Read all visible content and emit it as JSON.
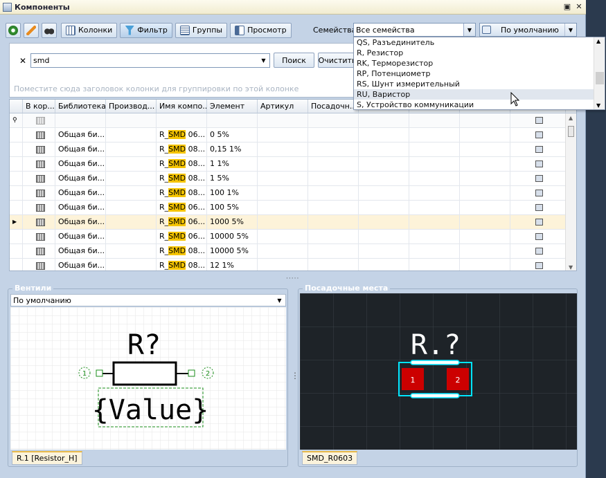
{
  "window": {
    "title": "Компоненты"
  },
  "toolbar": {
    "columns_label": "Колонки",
    "filter_label": "Фильтр",
    "groups_label": "Группы",
    "preview_label": "Просмотр"
  },
  "families": {
    "label": "Семейства",
    "value": "Все семейства",
    "view_value": "По умолчанию",
    "options": [
      "QS, Разъединитель",
      "R, Резистор",
      "RK, Терморезистор",
      "RP, Потенциометр",
      "RS, Шунт измерительный",
      "RU, Варистор",
      "S, Устройство коммуникации"
    ]
  },
  "search": {
    "value": "smd",
    "search_label": "Поиск",
    "clear_label": "Очистить",
    "group_hint": "Поместите сюда заголовок колонки для группировки по этой колонке"
  },
  "grid": {
    "columns": [
      "В кор...",
      "Библиотека",
      "Производ...",
      "Имя компо...",
      "Элемент",
      "Артикул",
      "Посадочн..."
    ],
    "rows": [
      {
        "lib": "Общая би...",
        "pre": "R_",
        "hl": "SMD",
        "post": " 06...",
        "elem": "0 5%"
      },
      {
        "lib": "Общая би...",
        "pre": "R_",
        "hl": "SMD",
        "post": " 08...",
        "elem": "0,15 1%"
      },
      {
        "lib": "Общая би...",
        "pre": "R_",
        "hl": "SMD",
        "post": " 08...",
        "elem": "1 1%"
      },
      {
        "lib": "Общая би...",
        "pre": "R_",
        "hl": "SMD",
        "post": " 08...",
        "elem": "1 5%"
      },
      {
        "lib": "Общая би...",
        "pre": "R_",
        "hl": "SMD",
        "post": " 08...",
        "elem": "100 1%"
      },
      {
        "lib": "Общая би...",
        "pre": "R_",
        "hl": "SMD",
        "post": " 06...",
        "elem": "100 5%"
      },
      {
        "lib": "Общая би...",
        "pre": "R_",
        "hl": "SMD",
        "post": " 06...",
        "elem": "1000 5%"
      },
      {
        "lib": "Общая би...",
        "pre": "R_",
        "hl": "SMD",
        "post": " 06...",
        "elem": "10000 5%"
      },
      {
        "lib": "Общая би...",
        "pre": "R_",
        "hl": "SMD",
        "post": " 08...",
        "elem": "10000 5%"
      },
      {
        "lib": "Общая би...",
        "pre": "R_",
        "hl": "SMD",
        "post": " 08...",
        "elem": "12 1%"
      }
    ]
  },
  "gates": {
    "title": "Вентили",
    "combo_value": "По умолчанию",
    "designator": "R?",
    "value_text": "{Value}",
    "pin1": "1",
    "pin2": "2",
    "tab": "R.1 [Resistor_H]"
  },
  "footprints": {
    "title": "Посадочные места",
    "designator": "R.?",
    "pad1": "1",
    "pad2": "2",
    "tab": "SMD_R0603"
  },
  "splitter_glyph": "·····",
  "vsplitter_glyph": "⋮",
  "colors": {
    "highlight": "#f5c400",
    "pad": "#cc0000",
    "outline": "#00e5ff",
    "footprint_bg": "#1e2328"
  }
}
